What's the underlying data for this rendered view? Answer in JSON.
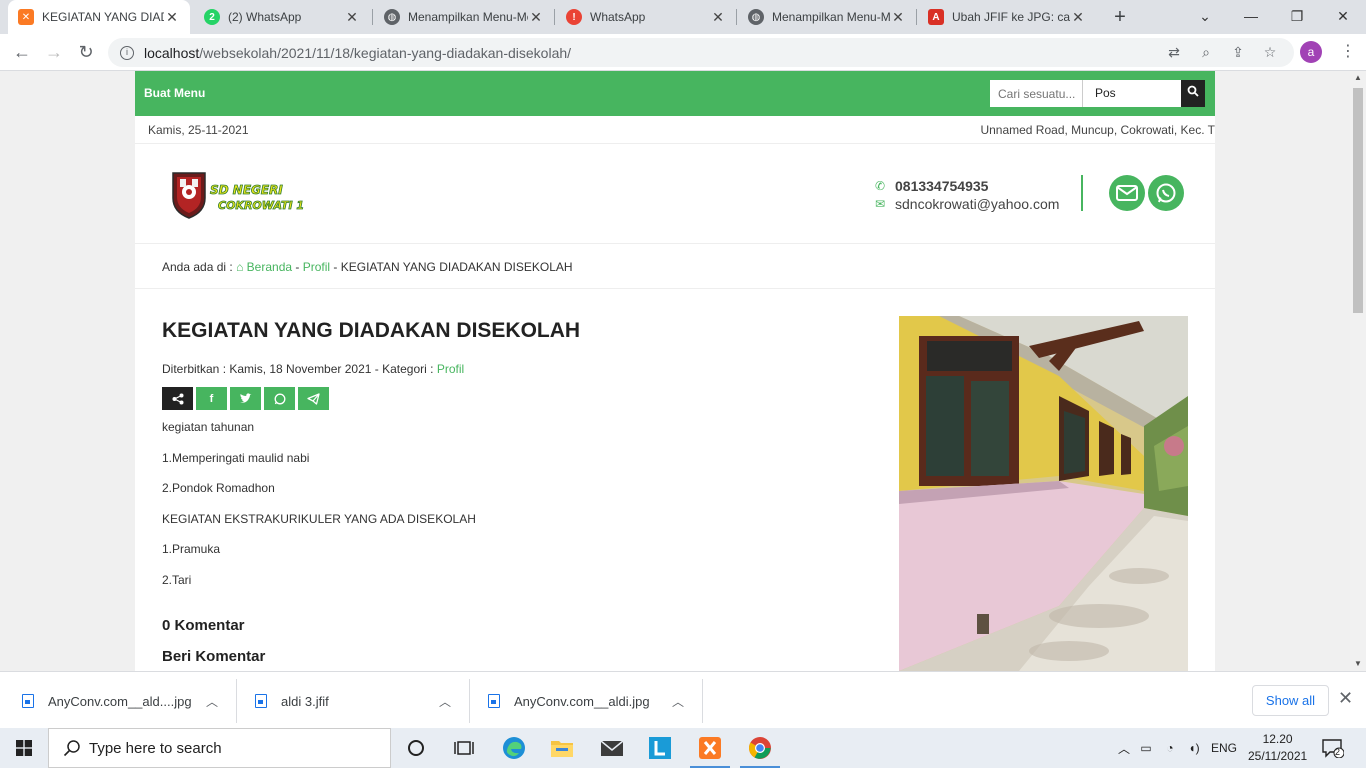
{
  "browser": {
    "tabs": [
      {
        "label": "KEGIATAN YANG DIADAKAN",
        "icon": "xampp-icon"
      },
      {
        "label": "(2) WhatsApp",
        "icon": "whatsapp-icon"
      },
      {
        "label": "Menampilkan Menu-Menu",
        "icon": "globe-icon"
      },
      {
        "label": "WhatsApp",
        "icon": "alert-icon"
      },
      {
        "label": "Menampilkan Menu-Menu",
        "icon": "globe-icon"
      },
      {
        "label": "Ubah JFIF ke JPG: cara",
        "icon": "pdf-icon"
      }
    ],
    "url_host": "localhost",
    "url_path": "/websekolah/2021/11/18/kegiatan-yang-diadakan-disekolah/",
    "profile_initial": "a"
  },
  "site": {
    "menu_label": "Buat Menu",
    "search": {
      "placeholder": "Cari sesuatu...",
      "type_selected": "Pos"
    },
    "date": "Kamis, 25-11-2021",
    "address": "Unnamed Road, Muncup, Cokrowati, Kec. T",
    "logo_text_line1": "SD NEGERI",
    "logo_text_line2": "COKROWATI 1",
    "phone": "081334754935",
    "email": "sdncokrowati@yahoo.com"
  },
  "breadcrumb": {
    "prefix": "Anda ada di :",
    "home": "Beranda",
    "sep1": " - ",
    "category": "Profil",
    "sep2": " - ",
    "current": "KEGIATAN YANG DIADAKAN DISEKOLAH"
  },
  "post": {
    "title": "KEGIATAN YANG DIADAKAN DISEKOLAH",
    "meta_prefix": "Diterbitkan : Kamis, 18 November 2021 - Kategori :",
    "meta_category": "Profil",
    "share_buttons": [
      "share-icon",
      "facebook-icon",
      "twitter-icon",
      "whatsapp-icon",
      "telegram-icon"
    ],
    "body": [
      "kegiatan tahunan",
      "1.Memperingati maulid nabi",
      "2.Pondok Romadhon",
      "KEGIATAN EKSTRAKURIKULER YANG ADA DISEKOLAH",
      "1.Pramuka",
      "2.Tari"
    ],
    "comments_count_label": "0 Komentar",
    "leave_comment_label": "Beri Komentar"
  },
  "downloads": {
    "items": [
      "AnyConv.com__ald....jpg",
      "aldi 3.jfif",
      "AnyConv.com__aldi.jpg"
    ],
    "show_all": "Show all"
  },
  "taskbar": {
    "search_placeholder": "Type here to search",
    "lang": "ENG",
    "time": "12.20",
    "date": "25/11/2021",
    "notifications": "2"
  },
  "colors": {
    "accent": "#47b55f",
    "dark": "#222222"
  }
}
